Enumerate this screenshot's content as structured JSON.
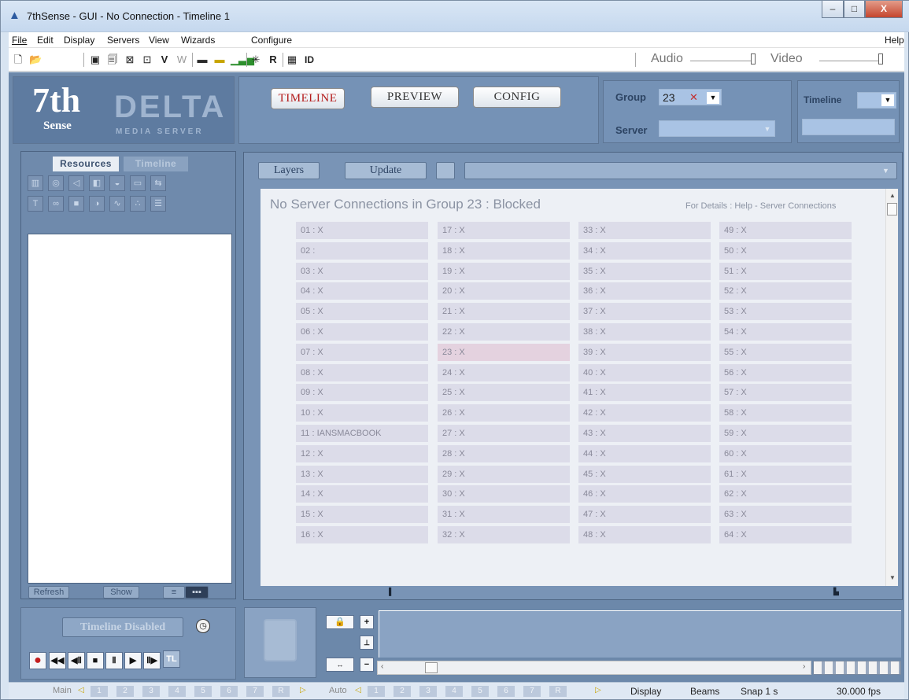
{
  "window": {
    "title": "7thSense -  GUI  - No Connection - Timeline 1",
    "min": "–",
    "max": "□",
    "close": "X"
  },
  "menu": {
    "file": "File",
    "edit": "Edit",
    "display": "Display",
    "servers": "Servers",
    "view": "View",
    "wizards": "Wizards",
    "configure": "Configure",
    "help": "Help"
  },
  "toolbar": {
    "v": "V",
    "w": "W",
    "r": "R",
    "id": "ID",
    "audio": "Audio",
    "video": "Video"
  },
  "logo": {
    "seven": "7th",
    "sense": "Sense",
    "delta": "DELTA",
    "sub": "MEDIA SERVER"
  },
  "nav": {
    "timeline": "TIMELINE",
    "preview": "PREVIEW",
    "config": "CONFIG"
  },
  "group": {
    "label": "Group",
    "value": "23",
    "clear": "✕",
    "server_label": "Server",
    "timeline_label": "Timeline"
  },
  "left": {
    "tab_resources": "Resources",
    "tab_timeline": "Timeline",
    "refresh": "Refresh",
    "show": "Show"
  },
  "main": {
    "layers": "Layers",
    "update": "Update",
    "message": "No Server Connections in Group 23 : Blocked",
    "details": "For Details : Help - Server Connections"
  },
  "servers": [
    [
      "01 : X",
      "02 :",
      "03 : X",
      "04 : X",
      "05 : X",
      "06 : X",
      "07 : X",
      "08 : X",
      "09 : X",
      "10 : X",
      "11 : IANSMACBOOK",
      "12 : X",
      "13 : X",
      "14 : X",
      "15 : X",
      "16 : X"
    ],
    [
      "17 : X",
      "18 : X",
      "19 : X",
      "20 : X",
      "21 : X",
      "22 : X",
      "23 : X",
      "24 : X",
      "25 : X",
      "26 : X",
      "27 : X",
      "28 : X",
      "29 : X",
      "30 : X",
      "31 : X",
      "32 : X"
    ],
    [
      "33 : X",
      "34 : X",
      "35 : X",
      "36 : X",
      "37 : X",
      "38 : X",
      "39 : X",
      "40 : X",
      "41 : X",
      "42 : X",
      "43 : X",
      "44 : X",
      "45 : X",
      "46 : X",
      "47 : X",
      "48 : X"
    ],
    [
      "49 : X",
      "50 : X",
      "51 : X",
      "52 : X",
      "53 : X",
      "54 : X",
      "55 : X",
      "56 : X",
      "57 : X",
      "58 : X",
      "59 : X",
      "60 : X",
      "61 : X",
      "62 : X",
      "63 : X",
      "64 : X"
    ]
  ],
  "transport": {
    "timeline_disabled": "Timeline Disabled",
    "tl": "TL"
  },
  "status": {
    "main": "Main",
    "auto": "Auto",
    "nums": [
      "1",
      "2",
      "3",
      "4",
      "5",
      "6",
      "7",
      "R"
    ],
    "display": "Display",
    "beams": "Beams",
    "snap": "Snap  1 s",
    "fps": "30.000 fps"
  },
  "colors": {
    "accent_red": "#b51c1c",
    "panel_blue": "#6c88aa",
    "cell_bg": "#dcdce9",
    "highlight": "#e4d2df"
  }
}
